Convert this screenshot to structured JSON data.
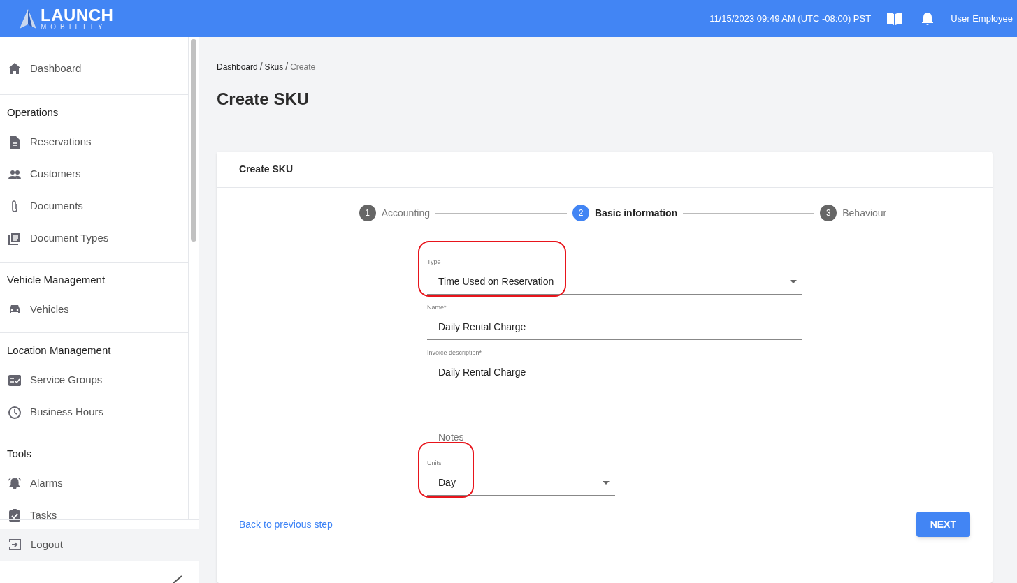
{
  "header": {
    "logo": {
      "word": "LAUNCH",
      "subword": "MOBILITY"
    },
    "datetime": "11/15/2023 09:49 AM (UTC -08:00) PST",
    "user": "User Employee"
  },
  "sidebar": {
    "sections": [
      {
        "items": [
          {
            "label": "Dashboard"
          }
        ]
      },
      {
        "title": "Operations",
        "items": [
          {
            "label": "Reservations"
          },
          {
            "label": "Customers"
          },
          {
            "label": "Documents"
          },
          {
            "label": "Document Types"
          }
        ]
      },
      {
        "title": "Vehicle Management",
        "items": [
          {
            "label": "Vehicles"
          }
        ]
      },
      {
        "title": "Location Management",
        "items": [
          {
            "label": "Service Groups"
          },
          {
            "label": "Business Hours"
          }
        ]
      },
      {
        "title": "Tools",
        "items": [
          {
            "label": "Alarms"
          },
          {
            "label": "Tasks"
          }
        ]
      }
    ],
    "logout": "Logout"
  },
  "breadcrumb": [
    {
      "kind": "link",
      "label": "Dashboard"
    },
    {
      "kind": "separator",
      "label": "/"
    },
    {
      "kind": "link",
      "label": "Skus"
    },
    {
      "kind": "separator",
      "label": "/"
    },
    {
      "kind": "current",
      "label": "Create"
    }
  ],
  "page_title": "Create SKU",
  "card": {
    "title": "Create SKU",
    "steps": [
      {
        "number": "1",
        "label": "Accounting",
        "selected": false
      },
      {
        "number": "2",
        "label": "Basic information",
        "selected": true
      },
      {
        "number": "3",
        "label": "Behaviour",
        "selected": false
      }
    ],
    "fields": [
      {
        "kind": "select",
        "label": "Type",
        "value": "Time Used on Reservation",
        "highlighted": true
      },
      {
        "kind": "text",
        "label": "Name*",
        "value": "Daily Rental Charge",
        "highlighted": false
      },
      {
        "kind": "text",
        "label": "Invoice description*",
        "value": "Daily Rental Charge",
        "highlighted": false
      },
      {
        "kind": "text",
        "placeholder": "Notes",
        "highlighted": false
      },
      {
        "kind": "short_select",
        "label": "Units",
        "value": "Day",
        "highlighted": true
      }
    ],
    "back_link": "Back to previous step",
    "next_button": "NEXT"
  }
}
